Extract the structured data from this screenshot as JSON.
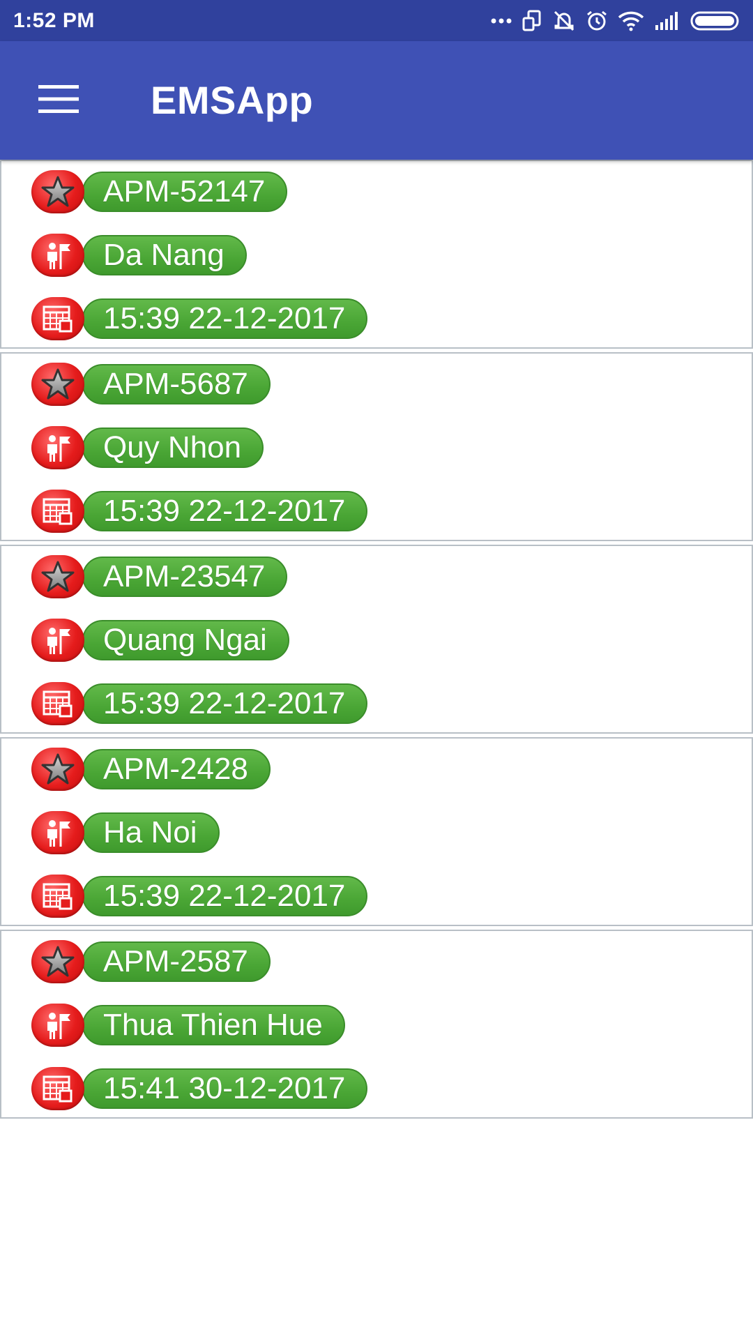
{
  "status_bar": {
    "time": "1:52 PM",
    "icons": [
      "more-dots-icon",
      "screen-rotate-icon",
      "silent-icon",
      "alarm-icon",
      "wifi-icon",
      "signal-icon",
      "battery-icon"
    ]
  },
  "app_bar": {
    "title": "EMSApp",
    "menu_icon": "hamburger-menu-icon",
    "background": "#3f51b5",
    "status_background": "#30419d"
  },
  "colors": {
    "pill_green": "#4aa635",
    "icon_red": "#e51c1c",
    "card_border": "#b8bfc6"
  },
  "items": [
    {
      "code": "APM-52147",
      "location": "Da Nang",
      "datetime": "15:39 22-12-2017"
    },
    {
      "code": "APM-5687",
      "location": "Quy Nhon",
      "datetime": "15:39 22-12-2017"
    },
    {
      "code": "APM-23547",
      "location": "Quang Ngai",
      "datetime": "15:39 22-12-2017"
    },
    {
      "code": "APM-2428",
      "location": "Ha Noi",
      "datetime": "15:39 22-12-2017"
    },
    {
      "code": "APM-2587",
      "location": "Thua Thien Hue",
      "datetime": "15:41 30-12-2017"
    }
  ],
  "row_icons": {
    "code": "star-icon",
    "location": "person-flag-icon",
    "datetime": "calendar-icon"
  }
}
